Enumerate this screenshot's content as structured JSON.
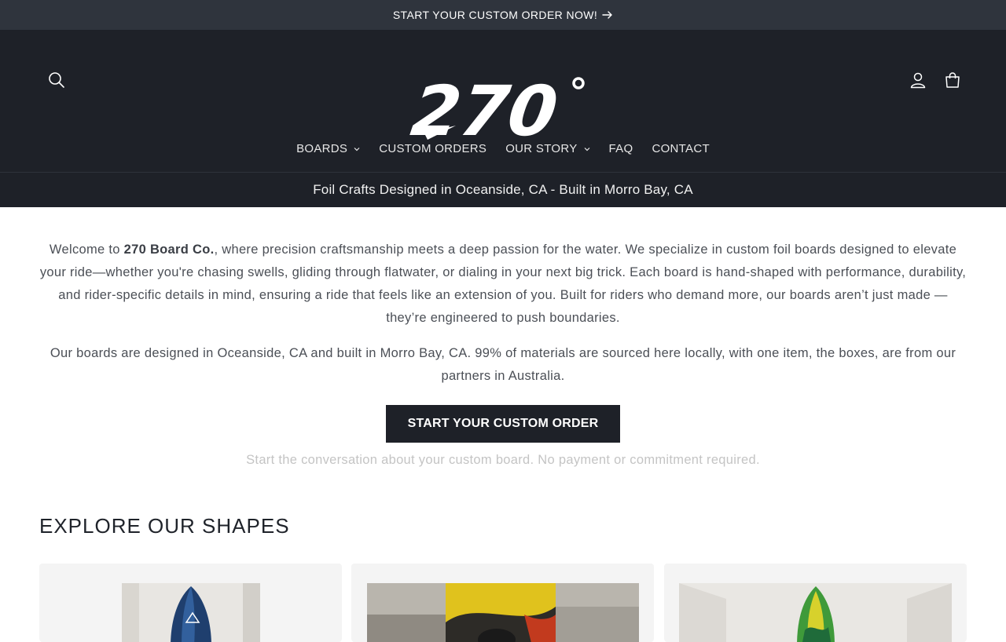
{
  "announcement": {
    "text": "START YOUR CUSTOM ORDER NOW!",
    "arrow_icon": "arrow-right-icon"
  },
  "header": {
    "logo_text": "270°",
    "icons": {
      "search": "search-icon",
      "account": "user-icon",
      "cart": "cart-icon"
    }
  },
  "nav": {
    "items": [
      {
        "label": "BOARDS",
        "has_dropdown": true
      },
      {
        "label": "CUSTOM ORDERS",
        "has_dropdown": false
      },
      {
        "label": "OUR STORY",
        "has_dropdown": true
      },
      {
        "label": "FAQ",
        "has_dropdown": false
      },
      {
        "label": "CONTACT",
        "has_dropdown": false
      }
    ]
  },
  "tagline": "Foil Crafts Designed in Oceanside, CA - Built in Morro Bay, CA",
  "intro": {
    "p1_before": "Welcome to ",
    "p1_bold": "270 Board Co.",
    "p1_after": ", where precision craftsmanship meets a deep passion for the water. We specialize in custom foil boards designed to elevate your ride—whether you're chasing swells, gliding through flatwater, or dialing in your next big trick. Each board is hand-shaped with performance, durability, and rider-specific details in mind, ensuring a ride that feels like an extension of you. Built for riders who demand more, our boards aren’t just made — they’re engineered to push boundaries.",
    "p2": "Our boards are designed in Oceanside, CA and built in Morro Bay, CA.  99% of materials are sourced here locally, with one item, the boxes, are from our partners in Australia."
  },
  "cta": {
    "label": "START YOUR CUSTOM ORDER",
    "note": "Start the conversation about your custom board. No payment or commitment required."
  },
  "shapes": {
    "title": "EXPLORE OUR SHAPES"
  },
  "colors": {
    "header_bg": "#1e2128",
    "announcement_bg": "#2f343d",
    "cta_bg": "#1e2128",
    "note": "#c4c4c4"
  }
}
